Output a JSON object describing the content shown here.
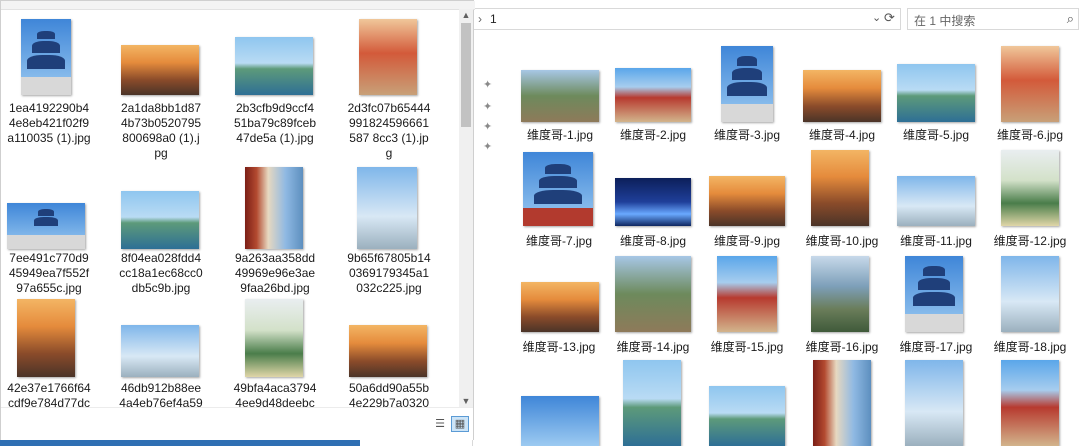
{
  "left_window": {
    "files": [
      "1ea4192290b44e8eb421f02f9a110035 (1).jpg",
      "2a1da8bb1d874b73b0520795800698a0 (1).jpg",
      "2b3cfb9d9ccf451ba79c89fceb47de5a (1).jpg",
      "2d3fc07b65444991824596661587 8cc3 (1).jpg",
      "7ee491c770d945949ea7f552f97a655c.jpg",
      "8f04ea028fdd4cc18a1ec68cc0db5c9b.jpg",
      "9a263aa358dd49969e96e3ae9faa26bd.jpg",
      "9b65f67805b140369179345a1032c225.jpg",
      "42e37e1766f64cdf9e784d77dc",
      "46db912b88ee4a4eb76ef4a59",
      "49bfa4aca37944ee9d48deebc",
      "50a6dd90a55b4e229b7a0320a"
    ]
  },
  "right_window": {
    "address": "1",
    "search_placeholder": "在 1 中搜索",
    "files": [
      "维度哥-1.jpg",
      "维度哥-2.jpg",
      "维度哥-3.jpg",
      "维度哥-4.jpg",
      "维度哥-5.jpg",
      "维度哥-6.jpg",
      "维度哥-7.jpg",
      "维度哥-8.jpg",
      "维度哥-9.jpg",
      "维度哥-10.jpg",
      "维度哥-11.jpg",
      "维度哥-12.jpg",
      "维度哥-13.jpg",
      "维度哥-14.jpg",
      "维度哥-15.jpg",
      "维度哥-16.jpg",
      "维度哥-17.jpg",
      "维度哥-18.jpg"
    ]
  },
  "icons": {
    "address_chevron": "chevron-right-icon",
    "refresh": "refresh-icon",
    "search": "search-icon",
    "pin": "pin-icon",
    "details_view": "details-view-icon",
    "thumbnail_view": "large-icons-view-icon"
  }
}
